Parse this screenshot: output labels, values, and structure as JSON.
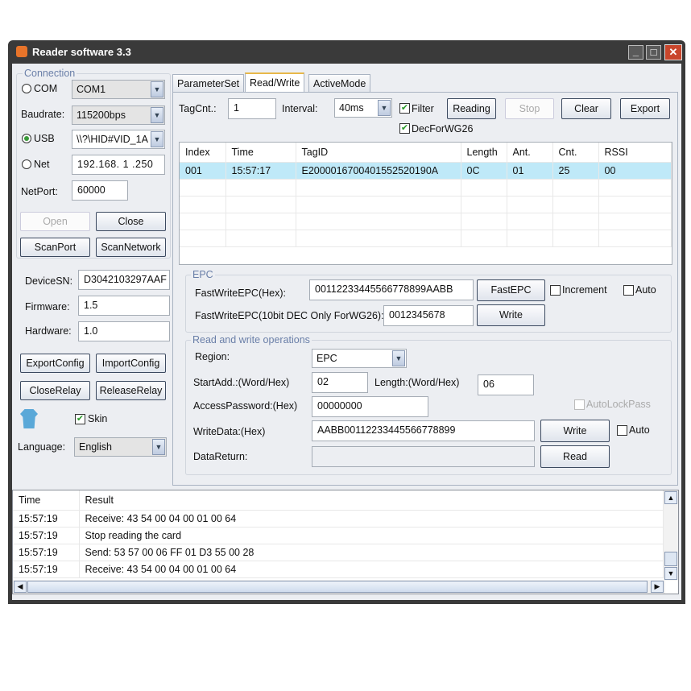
{
  "window": {
    "title": "Reader software 3.3"
  },
  "connection": {
    "title": "Connection",
    "com_label": "COM",
    "com_value": "COM1",
    "baud_label": "Baudrate:",
    "baud_value": "115200bps",
    "usb_label": "USB",
    "usb_value": "\\\\?\\HID#VID_1A",
    "net_label": "Net",
    "net_value": "192.168. 1 .250",
    "netport_label": "NetPort:",
    "netport_value": "60000",
    "selected": "USB",
    "open": "Open",
    "close": "Close",
    "scanport": "ScanPort",
    "scannetwork": "ScanNetwork"
  },
  "device": {
    "sn_label": "DeviceSN:",
    "sn_value": "D3042103297AAF",
    "fw_label": "Firmware:",
    "fw_value": "1.5",
    "hw_label": "Hardware:",
    "hw_value": "1.0",
    "export": "ExportConfig",
    "import": "ImportConfig",
    "closerelay": "CloseRelay",
    "releaserelay": "ReleaseRelay",
    "skin": "Skin",
    "language_label": "Language:",
    "language_value": "English"
  },
  "tabs": [
    "ParameterSet",
    "Read/Write",
    "ActiveMode"
  ],
  "rw": {
    "tagcnt_label": "TagCnt.:",
    "tagcnt_value": "1",
    "interval_label": "Interval:",
    "interval_value": "40ms",
    "filter": "Filter",
    "dec": "DecForWG26",
    "reading": "Reading",
    "stop": "Stop",
    "clear": "Clear",
    "export": "Export"
  },
  "tags": {
    "columns": [
      "Index",
      "Time",
      "TagID",
      "Length",
      "Ant.",
      "Cnt.",
      "RSSI"
    ],
    "rows": [
      [
        "001",
        "15:57:17",
        "E2000016700401552520190A",
        "0C",
        "01",
        "25",
        "00"
      ]
    ]
  },
  "epc": {
    "title": "EPC",
    "fast_label": "FastWriteEPC(Hex):",
    "fast_value": "00112233445566778899AABB",
    "fast_btn": "FastEPC",
    "increment": "Increment",
    "auto": "Auto",
    "wg_label": "FastWriteEPC(10bit DEC Only ForWG26):",
    "wg_value": "0012345678",
    "write": "Write"
  },
  "ops": {
    "title": "Read and write operations",
    "region_label": "Region:",
    "region_value": "EPC",
    "start_label": "StartAdd.:(Word/Hex)",
    "start_value": "02",
    "length_label": "Length:(Word/Hex)",
    "length_value": "06",
    "pwd_label": "AccessPassword:(Hex)",
    "pwd_value": "00000000",
    "autolock": "AutoLockPass",
    "wd_label": "WriteData:(Hex)",
    "wd_value": "AABB00112233445566778899",
    "write": "Write",
    "auto": "Auto",
    "dr_label": "DataReturn:",
    "read": "Read"
  },
  "log": {
    "columns": [
      "Time",
      "Result"
    ],
    "rows": [
      [
        "15:57:19",
        "Receive: 43 54 00 04 00 01 00 64"
      ],
      [
        "15:57:19",
        "Stop reading the card"
      ],
      [
        "15:57:19",
        "Send: 53 57 00 06 FF 01 D3 55 00 28"
      ],
      [
        "15:57:19",
        "Receive: 43 54 00 04 00 01 00 64"
      ]
    ]
  }
}
